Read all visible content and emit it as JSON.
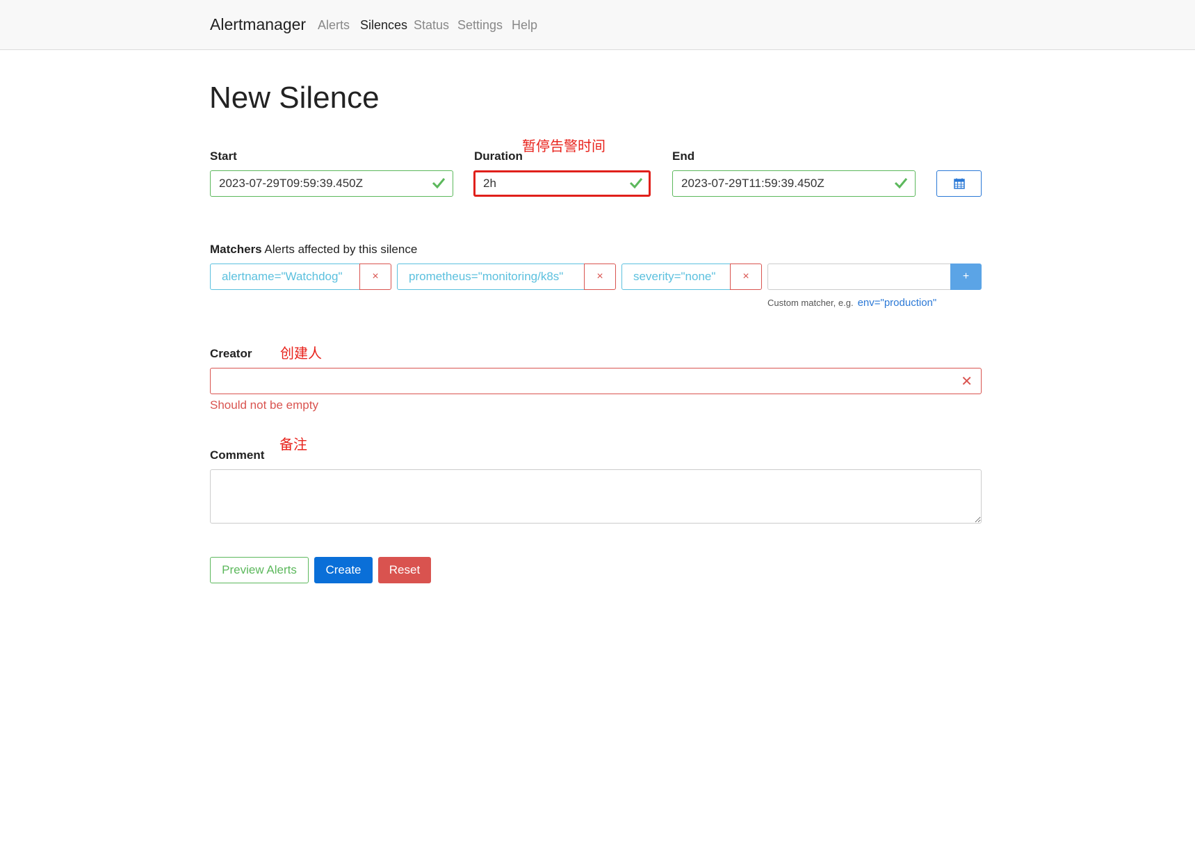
{
  "nav": {
    "brand": "Alertmanager",
    "links": [
      "Alerts",
      "Silences",
      "Status",
      "Settings",
      "Help"
    ],
    "active": "Silences"
  },
  "page_title": "New Silence",
  "annotations": {
    "duration": "暂停告警时间",
    "creator": "创建人",
    "comment": "备注"
  },
  "form": {
    "start": {
      "label": "Start",
      "value": "2023-07-29T09:59:39.450Z"
    },
    "duration": {
      "label": "Duration",
      "value": "2h"
    },
    "end": {
      "label": "End",
      "value": "2023-07-29T11:59:39.450Z"
    },
    "calendar_icon": "calendar-icon",
    "matchers": {
      "label_bold": "Matchers",
      "label_rest": " Alerts affected by this silence",
      "items": [
        "alertname=\"Watchdog\"",
        "prometheus=\"monitoring/k8s\"",
        "severity=\"none\""
      ],
      "remove_symbol": "×",
      "add_symbol": "+",
      "help_text": "Custom matcher, e.g.",
      "help_example": "env=\"production\""
    },
    "creator": {
      "label": "Creator",
      "value": "",
      "error": "Should not be empty",
      "error_symbol": "✕"
    },
    "comment": {
      "label": "Comment",
      "value": ""
    }
  },
  "buttons": {
    "preview": "Preview Alerts",
    "create": "Create",
    "reset": "Reset"
  },
  "colors": {
    "valid": "#5cb85c",
    "invalid": "#d9534f",
    "info": "#5bc0de",
    "primary": "#0a6fd8",
    "annotation": "#e8231c"
  }
}
